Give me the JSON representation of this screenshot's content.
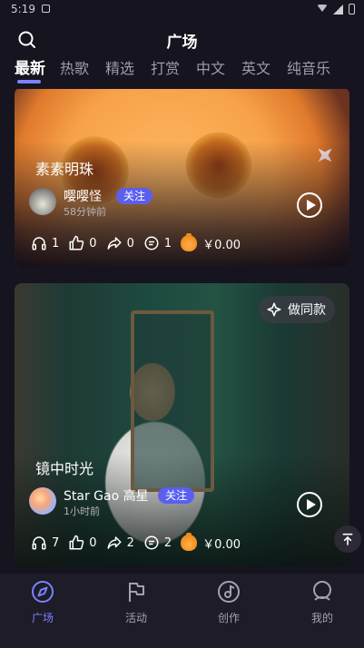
{
  "status_bar": {
    "time": "5:19"
  },
  "header": {
    "title": "广场",
    "search_icon": "search-icon"
  },
  "tabs": [
    {
      "label": "最新",
      "active": true
    },
    {
      "label": "热歌",
      "active": false
    },
    {
      "label": "精选",
      "active": false
    },
    {
      "label": "打赏",
      "active": false
    },
    {
      "label": "中文",
      "active": false
    },
    {
      "label": "英文",
      "active": false
    },
    {
      "label": "纯音乐",
      "active": false
    }
  ],
  "posts": [
    {
      "title": "素素明珠",
      "author": "嘤嘤怪",
      "follow_label": "关注",
      "time": "58分钟前",
      "stats": {
        "listens": "1",
        "likes": "0",
        "shares": "0",
        "comments": "1",
        "reward": "￥0.00"
      }
    },
    {
      "title": "镜中时光",
      "author": "Star Gao 高星",
      "follow_label": "关注",
      "time": "1小时前",
      "same_style_label": "做同款",
      "stats": {
        "listens": "7",
        "likes": "0",
        "shares": "2",
        "comments": "2",
        "reward": "￥0.00"
      }
    }
  ],
  "bottom_nav": [
    {
      "label": "广场",
      "icon": "compass-icon",
      "active": true
    },
    {
      "label": "活动",
      "icon": "flag-icon",
      "active": false
    },
    {
      "label": "创作",
      "icon": "music-disc-icon",
      "active": false
    },
    {
      "label": "我的",
      "icon": "profile-icon",
      "active": false
    }
  ],
  "colors": {
    "accent": "#7a83ff",
    "follow_bg": "#5b5ff0",
    "background": "#15141f"
  }
}
